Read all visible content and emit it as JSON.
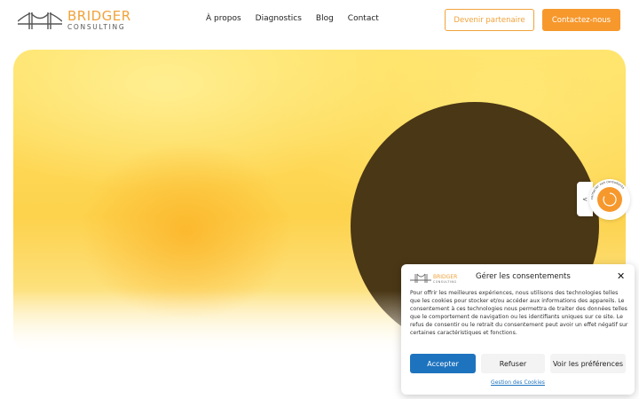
{
  "header": {
    "logo": {
      "name": "BRIDGER",
      "sub": "CONSULTING",
      "brand_color": "#f0a23a",
      "icon": "bridge-icon"
    },
    "nav": [
      "À propos",
      "Diagnostics",
      "Blog",
      "Contact"
    ],
    "partner_button": "Devenir partenaire",
    "contact_button": "Contactez-nous"
  },
  "hero": {
    "gradient_colors": [
      "#ffe36a",
      "#fcb428"
    ],
    "circle_color": "#4a3716"
  },
  "side_widget": {
    "tab_label": "<",
    "badge_ring_text": "contacter nos consultants"
  },
  "consent": {
    "logo_name": "BRIDGER",
    "logo_sub": "CONSULTING",
    "title": "Gérer les consentements",
    "close_icon": "close-icon",
    "body": "Pour offrir les meilleures expériences, nous utilisons des technologies telles que les cookies pour stocker et/ou accéder aux informations des appareils. Le consentement à ces technologies nous permettra de traiter des données telles que le comportement de navigation ou les identifiants uniques sur ce site. Le refus de consentir ou le retrait du consentement peut avoir un effet négatif sur certaines caractéristiques et fonctions.",
    "accept": "Accepter",
    "refuse": "Refuser",
    "preferences": "Voir les préférences",
    "link": "Gestion des Cookies",
    "accent_color": "#1e73be"
  }
}
